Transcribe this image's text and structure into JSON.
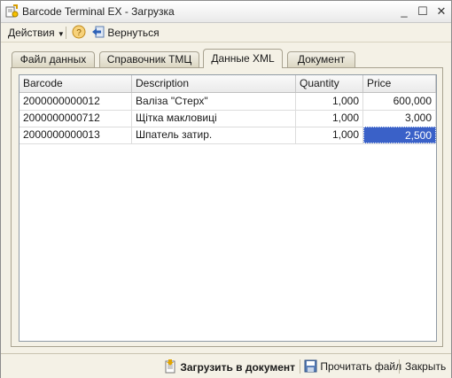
{
  "window": {
    "title": "Barcode Terminal EX - Загрузка"
  },
  "titlebar_buttons": {
    "minimize": "_",
    "maximize": "☐",
    "close": "✕"
  },
  "toolbar": {
    "actions_label": "Действия",
    "back_label": "Вернуться"
  },
  "tabs": [
    {
      "label": "Файл данных",
      "active": false
    },
    {
      "label": "Справочник ТМЦ",
      "active": false
    },
    {
      "label": "Данные XML",
      "active": true
    },
    {
      "label": "Документ",
      "active": false
    }
  ],
  "grid": {
    "columns": [
      "Barcode",
      "Description",
      "Quantity",
      "Price"
    ],
    "rows": [
      [
        "2000000000012",
        "Валіза \"Стерх\"",
        "1,000",
        "600,000"
      ],
      [
        "2000000000712",
        "Щітка макловиці",
        "1,000",
        "3,000"
      ],
      [
        "2000000000013",
        "Шпатель затир.",
        "1,000",
        "2,500"
      ]
    ],
    "selected": {
      "row": 2,
      "col": 3
    }
  },
  "bottom": {
    "load_label": "Загрузить в документ",
    "read_label": "Прочитать файл",
    "close_label": "Закрыть"
  },
  "colors": {
    "selection": "#3a61c8",
    "window_bg": "#f4f1e6"
  }
}
